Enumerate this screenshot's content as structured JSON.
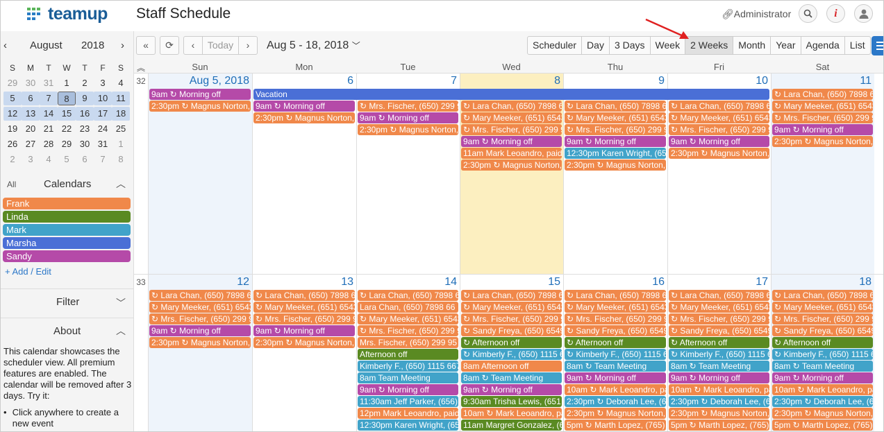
{
  "header": {
    "logo_text": "teamup",
    "title": "Staff Schedule",
    "admin_label": "Administrator"
  },
  "mini_calendar": {
    "month": "August",
    "year": "2018",
    "dow": [
      "S",
      "M",
      "T",
      "W",
      "T",
      "F",
      "S"
    ],
    "weeks": [
      [
        "29",
        "30",
        "31",
        "1",
        "2",
        "3",
        "4"
      ],
      [
        "5",
        "6",
        "7",
        "8",
        "9",
        "10",
        "11"
      ],
      [
        "12",
        "13",
        "14",
        "15",
        "16",
        "17",
        "18"
      ],
      [
        "19",
        "20",
        "21",
        "22",
        "23",
        "24",
        "25"
      ],
      [
        "26",
        "27",
        "28",
        "29",
        "30",
        "31",
        "1"
      ],
      [
        "2",
        "3",
        "4",
        "5",
        "6",
        "7",
        "8"
      ]
    ]
  },
  "calendars": {
    "all_label": "All",
    "title": "Calendars",
    "add_label": "+ Add / Edit",
    "items": [
      {
        "name": "Frank",
        "color": "#f0884a"
      },
      {
        "name": "Linda",
        "color": "#5a8a22"
      },
      {
        "name": "Mark",
        "color": "#41a3c9"
      },
      {
        "name": "Marsha",
        "color": "#4a6fd6"
      },
      {
        "name": "Sandy",
        "color": "#b54aa8"
      }
    ]
  },
  "filter": {
    "title": "Filter"
  },
  "about": {
    "title": "About",
    "text": "This calendar showcases the scheduler view. All premium features are enabled. The calendar will be removed after 3 days. Try it:",
    "bullet1": "Click anywhere to create a new event"
  },
  "toolbar": {
    "today": "Today",
    "range": "Aug 5 - 18, 2018",
    "views": [
      "Scheduler",
      "Day",
      "3 Days",
      "Week",
      "2 Weeks",
      "Month",
      "Year",
      "Agenda",
      "List"
    ],
    "active_view": "2 Weeks"
  },
  "grid": {
    "dow": [
      "Sun",
      "Mon",
      "Tue",
      "Wed",
      "Thu",
      "Fri",
      "Sat"
    ],
    "weeks": [
      {
        "num": "32",
        "days": [
          "Aug 5, 2018",
          "6",
          "7",
          "8",
          "9",
          "10",
          "11"
        ],
        "spanning": {
          "label": "Vacation",
          "color": "#4a6fd6",
          "from": 1,
          "to": 6
        },
        "events": [
          [
            {
              "t": "9am ↻ Morning off",
              "c": "#b54aa8"
            },
            {
              "t": "2:30pm ↻ Magnus Norton,",
              "c": "#f0884a"
            }
          ],
          [
            {
              "t": "9am ↻ Morning off",
              "c": "#b54aa8"
            },
            {
              "t": "2:30pm ↻ Magnus Norton,",
              "c": "#f0884a"
            }
          ],
          [
            {
              "t": "↻ Mrs. Fischer, (650) 299 9",
              "c": "#f0884a"
            },
            {
              "t": "9am ↻ Morning off",
              "c": "#b54aa8"
            },
            {
              "t": "2:30pm ↻ Magnus Norton,",
              "c": "#f0884a"
            }
          ],
          [
            {
              "t": "↻ Lara Chan, (650) 7898 6",
              "c": "#f0884a"
            },
            {
              "t": "↻ Mary Meeker, (651) 6543",
              "c": "#f0884a"
            },
            {
              "t": "↻ Mrs. Fischer, (650) 299 9",
              "c": "#f0884a"
            },
            {
              "t": "9am ↻ Morning off",
              "c": "#b54aa8"
            },
            {
              "t": "11am Mark Leoandro, paid",
              "c": "#f0884a"
            },
            {
              "t": "2:30pm ↻ Magnus Norton,",
              "c": "#f0884a"
            }
          ],
          [
            {
              "t": "↻ Lara Chan, (650) 7898 6",
              "c": "#f0884a"
            },
            {
              "t": "↻ Mary Meeker, (651) 6543",
              "c": "#f0884a"
            },
            {
              "t": "↻ Mrs. Fischer, (650) 299 9",
              "c": "#f0884a"
            },
            {
              "t": "9am ↻ Morning off",
              "c": "#b54aa8"
            },
            {
              "t": "12:30pm Karen Wright, (65",
              "c": "#41a3c9"
            },
            {
              "t": "2:30pm ↻ Magnus Norton,",
              "c": "#f0884a"
            }
          ],
          [
            {
              "t": "↻ Lara Chan, (650) 7898 6",
              "c": "#f0884a"
            },
            {
              "t": "↻ Mary Meeker, (651) 6543",
              "c": "#f0884a"
            },
            {
              "t": "↻ Mrs. Fischer, (650) 299 9",
              "c": "#f0884a"
            },
            {
              "t": "9am ↻ Morning off",
              "c": "#b54aa8"
            },
            {
              "t": "2:30pm ↻ Magnus Norton,",
              "c": "#f0884a"
            }
          ],
          [
            {
              "t": "↻ Lara Chan, (650) 7898 6",
              "c": "#f0884a"
            },
            {
              "t": "↻ Mary Meeker, (651) 6543",
              "c": "#f0884a"
            },
            {
              "t": "↻ Mrs. Fischer, (650) 299 9",
              "c": "#f0884a"
            },
            {
              "t": "9am ↻ Morning off",
              "c": "#b54aa8"
            },
            {
              "t": "2:30pm ↻ Magnus Norton,",
              "c": "#f0884a"
            }
          ]
        ]
      },
      {
        "num": "33",
        "days": [
          "12",
          "13",
          "14",
          "15",
          "16",
          "17",
          "18"
        ],
        "events": [
          [
            {
              "t": "↻ Lara Chan, (650) 7898 6",
              "c": "#f0884a"
            },
            {
              "t": "↻ Mary Meeker, (651) 6543",
              "c": "#f0884a"
            },
            {
              "t": "↻ Mrs. Fischer, (650) 299 9",
              "c": "#f0884a"
            },
            {
              "t": "9am ↻ Morning off",
              "c": "#b54aa8"
            },
            {
              "t": "2:30pm ↻ Magnus Norton,",
              "c": "#f0884a"
            }
          ],
          [
            {
              "t": "↻ Lara Chan, (650) 7898 6",
              "c": "#f0884a"
            },
            {
              "t": "↻ Mary Meeker, (651) 6543",
              "c": "#f0884a"
            },
            {
              "t": "↻ Mrs. Fischer, (650) 299 9",
              "c": "#f0884a"
            },
            {
              "t": "9am ↻ Morning off",
              "c": "#b54aa8"
            },
            {
              "t": "2:30pm ↻ Magnus Norton,",
              "c": "#f0884a"
            }
          ],
          [
            {
              "t": "↻ Lara Chan, (650) 7898 6",
              "c": "#f0884a"
            },
            {
              "t": "Lara Chan, (650) 7898 66",
              "c": "#f0884a"
            },
            {
              "t": "↻ Mary Meeker, (651) 6543",
              "c": "#f0884a"
            },
            {
              "t": "↻ Mrs. Fischer, (650) 299 9",
              "c": "#f0884a"
            },
            {
              "t": "Mrs. Fischer, (650) 299 95",
              "c": "#f0884a"
            },
            {
              "t": "Afternoon off",
              "c": "#5a8a22"
            },
            {
              "t": "Kimberly F., (650) 1115 667",
              "c": "#41a3c9"
            },
            {
              "t": "8am Team Meeting",
              "c": "#41a3c9"
            },
            {
              "t": "9am ↻ Morning off",
              "c": "#b54aa8"
            },
            {
              "t": "11:30am Jeff Parker, (656)",
              "c": "#41a3c9"
            },
            {
              "t": "12pm Mark Leoandro, paid",
              "c": "#f0884a"
            },
            {
              "t": "12:30pm Karen Wright, (65",
              "c": "#41a3c9"
            }
          ],
          [
            {
              "t": "↻ Lara Chan, (650) 7898 6",
              "c": "#f0884a"
            },
            {
              "t": "↻ Mary Meeker, (651) 6543",
              "c": "#f0884a"
            },
            {
              "t": "↻ Mrs. Fischer, (650) 299 9",
              "c": "#f0884a"
            },
            {
              "t": "↻ Sandy Freya, (650) 6549",
              "c": "#f0884a"
            },
            {
              "t": "↻ Afternoon off",
              "c": "#5a8a22"
            },
            {
              "t": "↻ Kimberly F., (650) 1115 6",
              "c": "#41a3c9"
            },
            {
              "t": "8am Afternoon off",
              "c": "#f0884a"
            },
            {
              "t": "8am ↻ Team Meeting",
              "c": "#41a3c9"
            },
            {
              "t": "9am ↻ Morning off",
              "c": "#b54aa8"
            },
            {
              "t": "9:30am Trisha Lewis, (651",
              "c": "#5a8a22"
            },
            {
              "t": "10am ↻ Mark Leoandro, pa",
              "c": "#f0884a"
            },
            {
              "t": "11am Margret Gonzalez, (6",
              "c": "#5a8a22"
            }
          ],
          [
            {
              "t": "↻ Lara Chan, (650) 7898 6",
              "c": "#f0884a"
            },
            {
              "t": "↻ Mary Meeker, (651) 6543",
              "c": "#f0884a"
            },
            {
              "t": "↻ Mrs. Fischer, (650) 299 9",
              "c": "#f0884a"
            },
            {
              "t": "↻ Sandy Freya, (650) 6549",
              "c": "#f0884a"
            },
            {
              "t": "↻ Afternoon off",
              "c": "#5a8a22"
            },
            {
              "t": "↻ Kimberly F., (650) 1115 6",
              "c": "#41a3c9"
            },
            {
              "t": "8am ↻ Team Meeting",
              "c": "#41a3c9"
            },
            {
              "t": "9am ↻ Morning off",
              "c": "#b54aa8"
            },
            {
              "t": "10am ↻ Mark Leoandro, pa",
              "c": "#f0884a"
            },
            {
              "t": "2:30pm ↻ Deborah Lee, (6",
              "c": "#41a3c9"
            },
            {
              "t": "2:30pm ↻ Magnus Norton,",
              "c": "#f0884a"
            },
            {
              "t": "5pm ↻ Marth Lopez, (765)",
              "c": "#f0884a"
            }
          ],
          [
            {
              "t": "↻ Lara Chan, (650) 7898 6",
              "c": "#f0884a"
            },
            {
              "t": "↻ Mary Meeker, (651) 6543",
              "c": "#f0884a"
            },
            {
              "t": "↻ Mrs. Fischer, (650) 299 9",
              "c": "#f0884a"
            },
            {
              "t": "↻ Sandy Freya, (650) 6549",
              "c": "#f0884a"
            },
            {
              "t": "↻ Afternoon off",
              "c": "#5a8a22"
            },
            {
              "t": "↻ Kimberly F., (650) 1115 6",
              "c": "#41a3c9"
            },
            {
              "t": "8am ↻ Team Meeting",
              "c": "#41a3c9"
            },
            {
              "t": "9am ↻ Morning off",
              "c": "#b54aa8"
            },
            {
              "t": "10am ↻ Mark Leoandro, pa",
              "c": "#f0884a"
            },
            {
              "t": "2:30pm ↻ Deborah Lee, (6",
              "c": "#41a3c9"
            },
            {
              "t": "2:30pm ↻ Magnus Norton,",
              "c": "#f0884a"
            },
            {
              "t": "5pm ↻ Marth Lopez, (765)",
              "c": "#f0884a"
            }
          ],
          [
            {
              "t": "↻ Lara Chan, (650) 7898 6",
              "c": "#f0884a"
            },
            {
              "t": "↻ Mary Meeker, (651) 6543",
              "c": "#f0884a"
            },
            {
              "t": "↻ Mrs. Fischer, (650) 299 9",
              "c": "#f0884a"
            },
            {
              "t": "↻ Sandy Freya, (650) 6549",
              "c": "#f0884a"
            },
            {
              "t": "↻ Afternoon off",
              "c": "#5a8a22"
            },
            {
              "t": "↻ Kimberly F., (650) 1115 6",
              "c": "#41a3c9"
            },
            {
              "t": "8am ↻ Team Meeting",
              "c": "#41a3c9"
            },
            {
              "t": "9am ↻ Morning off",
              "c": "#b54aa8"
            },
            {
              "t": "10am ↻ Mark Leoandro, pa",
              "c": "#f0884a"
            },
            {
              "t": "2:30pm ↻ Deborah Lee, (6",
              "c": "#41a3c9"
            },
            {
              "t": "2:30pm ↻ Magnus Norton,",
              "c": "#f0884a"
            },
            {
              "t": "5pm ↻ Marth Lopez, (765)",
              "c": "#f0884a"
            }
          ]
        ]
      }
    ]
  }
}
